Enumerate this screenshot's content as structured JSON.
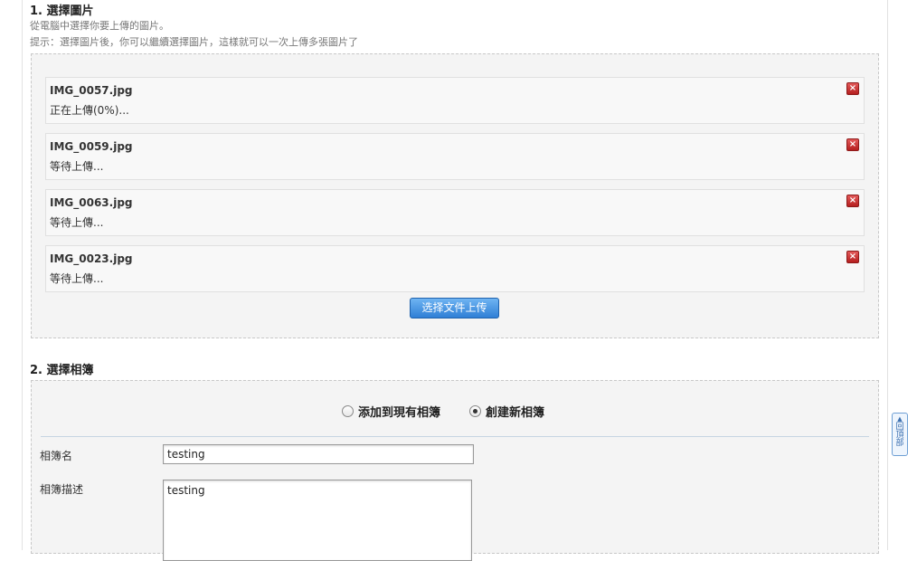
{
  "step1": {
    "title": "1. 選擇圖片",
    "hint1": "從電腦中選擇你要上傳的圖片。",
    "hint2": "提示：選擇圖片後，你可以繼續選擇圖片，這樣就可以一次上傳多張圖片了"
  },
  "files": [
    {
      "name": "IMG_0057.jpg",
      "status": "正在上傳(0%)..."
    },
    {
      "name": "IMG_0059.jpg",
      "status": "等待上傳..."
    },
    {
      "name": "IMG_0063.jpg",
      "status": "等待上傳..."
    },
    {
      "name": "IMG_0023.jpg",
      "status": "等待上傳..."
    }
  ],
  "upload_button_label": "选择文件上传",
  "step2": {
    "title": "2. 選擇相簿",
    "option_existing": "添加到現有相簿",
    "option_new": "創建新相簿",
    "selected": "option_new",
    "album_name_label": "相簿名",
    "album_name_value": "testing",
    "album_desc_label": "相簿描述",
    "album_desc_value": "testing"
  },
  "back_to_top": "回頂部",
  "icons": {
    "remove": "remove-icon",
    "back_to_top": "up-arrow-icon"
  },
  "colors": {
    "button_blue": "#2f7fd6",
    "remove_red": "#c43333"
  }
}
